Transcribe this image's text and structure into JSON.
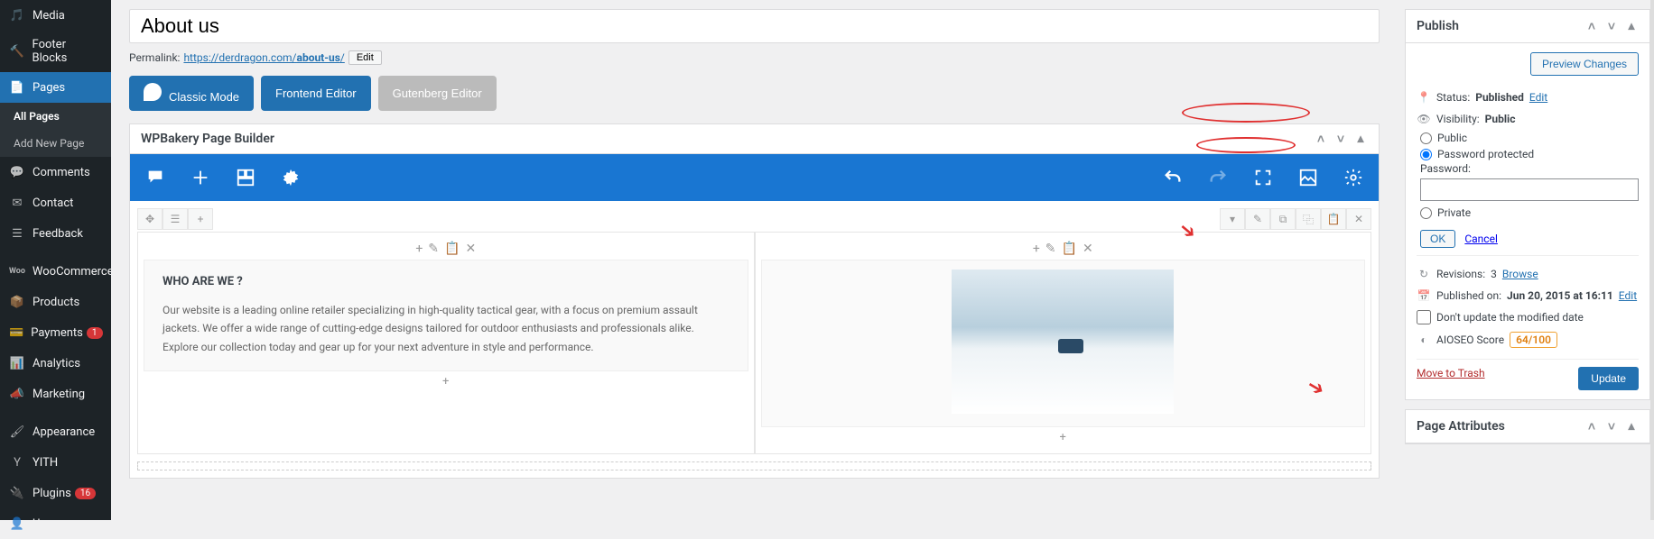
{
  "sidebar": {
    "items": [
      {
        "label": "Media",
        "icon": "media"
      },
      {
        "label": "Footer Blocks",
        "icon": "hammer"
      },
      {
        "label": "Pages",
        "icon": "page",
        "active": true
      },
      {
        "label": "Comments",
        "icon": "comment"
      },
      {
        "label": "Contact",
        "icon": "mail"
      },
      {
        "label": "Feedback",
        "icon": "feedback"
      },
      {
        "label": "WooCommerce",
        "icon": "woo"
      },
      {
        "label": "Products",
        "icon": "box"
      },
      {
        "label": "Payments",
        "icon": "card",
        "badge": "1"
      },
      {
        "label": "Analytics",
        "icon": "chart"
      },
      {
        "label": "Marketing",
        "icon": "megaphone"
      },
      {
        "label": "Appearance",
        "icon": "brush"
      },
      {
        "label": "YITH",
        "icon": "y"
      },
      {
        "label": "Plugins",
        "icon": "plug",
        "badge": "16"
      },
      {
        "label": "Users",
        "icon": "user"
      }
    ],
    "sub": [
      {
        "label": "All Pages",
        "active": true
      },
      {
        "label": "Add New Page"
      }
    ]
  },
  "page": {
    "title": "About us",
    "permalink_label": "Permalink:",
    "permalink_base": "https://derdragon.com/",
    "permalink_slug": "about-us",
    "permalink_trail": "/",
    "edit_label": "Edit"
  },
  "editor_tabs": {
    "classic": "Classic Mode",
    "frontend": "Frontend Editor",
    "gutenberg": "Gutenberg Editor"
  },
  "builder": {
    "title": "WPBakery Page Builder",
    "block_title": "WHO ARE WE ?",
    "block_text": "Our website is a leading online retailer specializing in high-quality tactical gear, with a focus on premium assault jackets. We offer a wide range of cutting-edge designs tailored for outdoor enthusiasts and professionals alike. Explore our collection today and gear up for your next adventure in style and performance."
  },
  "publish": {
    "title": "Publish",
    "preview": "Preview Changes",
    "status_label": "Status:",
    "status_value": "Published",
    "status_edit": "Edit",
    "visibility_label": "Visibility:",
    "visibility_value": "Public",
    "opt_public": "Public",
    "opt_password": "Password protected",
    "opt_private": "Private",
    "password_label": "Password:",
    "ok": "OK",
    "cancel": "Cancel",
    "revisions_label": "Revisions:",
    "revisions_count": "3",
    "browse": "Browse",
    "published_on_label": "Published on:",
    "published_on_value": "Jun 20, 2015 at 16:11",
    "published_edit": "Edit",
    "dont_update": "Don't update the modified date",
    "aioseo_label": "AIOSEO Score",
    "aioseo_score": "64/100",
    "trash": "Move to Trash",
    "update": "Update"
  },
  "page_attributes": {
    "title": "Page Attributes"
  }
}
